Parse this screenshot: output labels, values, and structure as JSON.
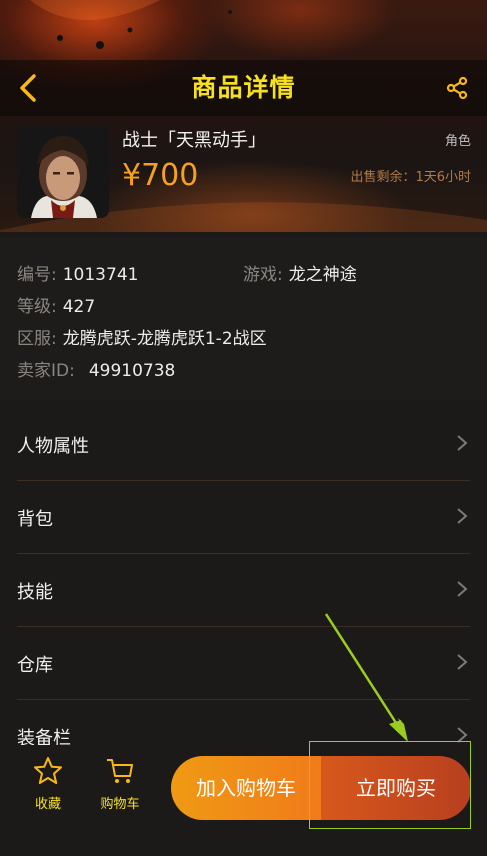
{
  "header": {
    "title": "商品详情",
    "back_icon": "chevron-left-icon",
    "share_icon": "share-icon"
  },
  "product": {
    "name": "战士「天黑动手」",
    "price": "¥700",
    "type": "角色",
    "time_left": "出售剩余：1天6小时"
  },
  "info": {
    "id_label": "编号:",
    "id_value": "1013741",
    "game_label": "游戏:",
    "game_value": "龙之神途",
    "level_label": "等级:",
    "level_value": "427",
    "server_label": "区服:",
    "server_value": "龙腾虎跃-龙腾虎跃1-2战区",
    "seller_label": "卖家ID:",
    "seller_value": "49910738"
  },
  "menu": {
    "items": [
      {
        "label": "人物属性"
      },
      {
        "label": "背包"
      },
      {
        "label": "技能"
      },
      {
        "label": "仓库"
      },
      {
        "label": "装备栏"
      }
    ]
  },
  "bottom": {
    "favorite_label": "收藏",
    "cart_label": "购物车",
    "add_to_cart": "加入购物车",
    "buy_now": "立即购买"
  },
  "colors": {
    "title_yellow": "#f7e020",
    "price_orange": "#f7a020",
    "cart_button": "#f09a14",
    "buy_button": "#c84a1d",
    "annotation_green": "#9acd20"
  }
}
